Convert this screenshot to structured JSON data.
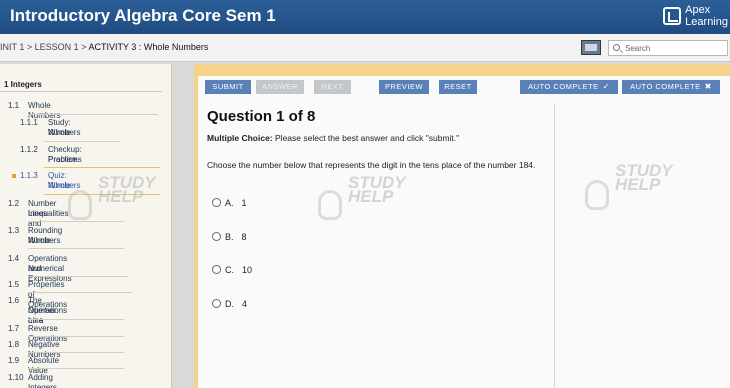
{
  "header": {
    "title": "Introductory Algebra Core Sem 1",
    "logo_line1": "Apex",
    "logo_line2": "Learning"
  },
  "breadcrumb": {
    "unit": "INIT 1",
    "lesson": "LESSON 1",
    "current": "ACTIVITY 3 : Whole Numbers",
    "sep": ">"
  },
  "search": {
    "placeholder": "Search"
  },
  "sidebar": {
    "header": "1   Integers",
    "items": [
      {
        "num": "1.1",
        "label": "Whole Numbers",
        "level": 1
      },
      {
        "num": "1.1.1",
        "label": "Study: Whole",
        "label2": "Numbers",
        "level": 2
      },
      {
        "num": "1.1.2",
        "label": "Checkup: Practice",
        "label2": "Problems",
        "level": 2
      },
      {
        "num": "1.1.3",
        "label": "Quiz: Whole",
        "label2": "Numbers",
        "level": 2,
        "active": true
      },
      {
        "num": "1.2",
        "label": "Number Lines and",
        "label2": "Inequalities",
        "level": 1
      },
      {
        "num": "1.3",
        "label": "Rounding Whole",
        "label2": "Numbers",
        "level": 1
      },
      {
        "num": "1.4",
        "label": "Operations and",
        "label2": "Numerical Expressions",
        "level": 1
      },
      {
        "num": "1.5",
        "label": "Properties of Operations",
        "level": 1
      },
      {
        "num": "1.6",
        "label": "The Operations on a",
        "label2": "Number Line",
        "level": 1
      },
      {
        "num": "1.7",
        "label": "Reverse Operations",
        "level": 1
      },
      {
        "num": "1.8",
        "label": "Negative Numbers",
        "level": 1
      },
      {
        "num": "1.9",
        "label": "Absolute Value",
        "level": 1
      },
      {
        "num": "1.10",
        "label": "Adding Integers",
        "level": 1
      }
    ]
  },
  "toolbar": {
    "submit": "SUBMIT",
    "answer": "ANSWER",
    "next": "NEXT",
    "preview": "PREVIEW",
    "reset": "RESET",
    "auto_complete_check": "AUTO COMPLETE",
    "auto_complete_x": "AUTO COMPLETE"
  },
  "question": {
    "title": "Question 1 of 8",
    "type_label": "Multiple Choice:",
    "type_instruction": "Please select the best answer and click \"submit.\"",
    "text": "Choose the number below that represents the digit in the tens place of the number 184.",
    "options": [
      {
        "letter": "A.",
        "value": "1"
      },
      {
        "letter": "B.",
        "value": "8"
      },
      {
        "letter": "C.",
        "value": "10"
      },
      {
        "letter": "D.",
        "value": "4"
      }
    ]
  },
  "watermark": {
    "line1": "STUDY",
    "line2": "HELP"
  },
  "colors": {
    "header": "#1f4c82",
    "panel_accent": "#f4d48a",
    "button": "#5a80b8",
    "active_bullet": "#e3a51c"
  }
}
